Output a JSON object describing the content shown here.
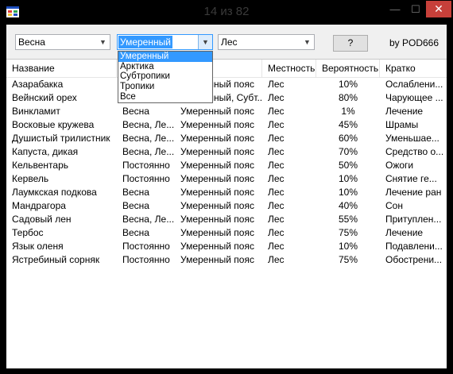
{
  "window": {
    "title": "14 из 82",
    "min_glyph": "—",
    "max_glyph": "☐",
    "close_glyph": "✕"
  },
  "filters": {
    "season": "Весна",
    "zone": "Умеренный",
    "terrain": "Лес",
    "help_button": "?",
    "author": "by POD666"
  },
  "zone_options": [
    {
      "label": "Умеренный",
      "selected": true
    },
    {
      "label": "Арктика",
      "selected": false
    },
    {
      "label": "Субтропики",
      "selected": false
    },
    {
      "label": "Тропики",
      "selected": false
    },
    {
      "label": "Все",
      "selected": false
    }
  ],
  "table": {
    "columns": [
      "Название",
      "",
      "",
      "Местность",
      "Вероятность",
      "Кратко"
    ],
    "rows": [
      [
        "Азарабакка",
        "",
        "Умеренный пояс",
        "Лес",
        "10%",
        "Ослаблени..."
      ],
      [
        "Вейнский орех",
        "",
        "Умеренный, Субт...",
        "Лес",
        "80%",
        "Чарующее ..."
      ],
      [
        "Винкламит",
        "Весна",
        "Умеренный пояс",
        "Лес",
        "1%",
        "Лечение"
      ],
      [
        "Восковые кружева",
        "Весна, Ле...",
        "Умеренный пояс",
        "Лес",
        "45%",
        "Шрамы"
      ],
      [
        "Душистый трилистник",
        "Весна, Ле...",
        "Умеренный пояс",
        "Лес",
        "60%",
        "Уменьшае..."
      ],
      [
        "Капуста, дикая",
        "Весна, Ле...",
        "Умеренный пояс",
        "Лес",
        "70%",
        "Средство о..."
      ],
      [
        "Кельвентарь",
        "Постоянно",
        "Умеренный пояс",
        "Лес",
        "50%",
        "Ожоги"
      ],
      [
        "Кервель",
        "Постоянно",
        "Умеренный пояс",
        "Лес",
        "10%",
        "Снятие ге..."
      ],
      [
        "Лаумкская подкова",
        "Весна",
        "Умеренный пояс",
        "Лес",
        "10%",
        "Лечение ран"
      ],
      [
        "Мандрагора",
        "Весна",
        "Умеренный пояс",
        "Лес",
        "40%",
        "Сон"
      ],
      [
        "Садовый лен",
        "Весна, Ле...",
        "Умеренный пояс",
        "Лес",
        "55%",
        "Притуплен..."
      ],
      [
        "Тербос",
        "Весна",
        "Умеренный пояс",
        "Лес",
        "75%",
        "Лечение"
      ],
      [
        "Язык оленя",
        "Постоянно",
        "Умеренный пояс",
        "Лес",
        "10%",
        "Подавлени..."
      ],
      [
        "Ястребиный сорняк",
        "Постоянно",
        "Умеренный пояс",
        "Лес",
        "75%",
        "Обострени..."
      ]
    ]
  },
  "icons": {
    "app": "app-window-icon",
    "dropdown": "chevron-down-icon"
  }
}
